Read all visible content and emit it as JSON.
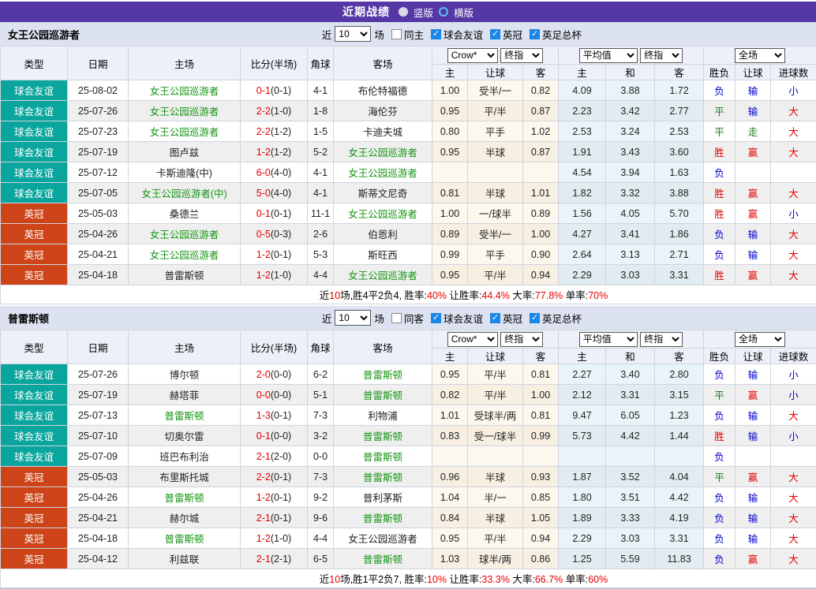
{
  "title_bar": {
    "title": "近期战绩",
    "vertical_label": "竖版",
    "horizontal_label": "横版"
  },
  "icons": {
    "check": "✓"
  },
  "colors": {
    "purple": "#5537a5",
    "teal": "#0aa69e",
    "red_orange": "#cc4417",
    "team_green": "#149414",
    "win_red": "#e60000",
    "lose_blue": "#0000cc",
    "draw_green": "#108010",
    "checkbox_blue": "#1a86e8"
  },
  "filters_common": {
    "near": "近",
    "count": "10",
    "matches": "场",
    "comps": [
      "球会友谊",
      "英冠",
      "英足总杯"
    ]
  },
  "header_selects": {
    "crow": "Crow*",
    "final": "终指",
    "avg": "平均值",
    "full": "全场"
  },
  "headers": {
    "type": "类型",
    "date": "日期",
    "home": "主场",
    "score": "比分(半场)",
    "corner": "角球",
    "away": "客场",
    "h_home": "主",
    "h_handicap": "让球",
    "h_away": "客",
    "a_home": "主",
    "a_draw": "和",
    "a_away": "客",
    "r_result": "胜负",
    "r_handicap": "让球",
    "r_goals": "进球数"
  },
  "sections": [
    {
      "team": "女王公园巡游者",
      "filter": {
        "same_label": "同主",
        "same_checked": false
      },
      "rows": [
        {
          "type": "球会友谊",
          "tc": "t",
          "date": "25-08-02",
          "home": "女王公园巡游者",
          "hg": true,
          "score": "0-1",
          "half": "(0-1)",
          "corner": "4-1",
          "away": "布伦特福德",
          "ag": false,
          "odds": [
            "1.00",
            "受半/一",
            "0.82"
          ],
          "avg": [
            "4.09",
            "3.88",
            "1.72"
          ],
          "res": [
            [
              "负",
              "b"
            ],
            [
              "输",
              "b"
            ],
            [
              "小",
              "b"
            ]
          ]
        },
        {
          "type": "球会友谊",
          "tc": "t",
          "date": "25-07-26",
          "home": "女王公园巡游者",
          "hg": true,
          "score": "2-2",
          "half": "(1-0)",
          "corner": "1-8",
          "away": "海伦芬",
          "ag": false,
          "odds": [
            "0.95",
            "平/半",
            "0.87"
          ],
          "avg": [
            "2.23",
            "3.42",
            "2.77"
          ],
          "res": [
            [
              "平",
              "g"
            ],
            [
              "输",
              "b"
            ],
            [
              "大",
              "r"
            ]
          ]
        },
        {
          "type": "球会友谊",
          "tc": "t",
          "date": "25-07-23",
          "home": "女王公园巡游者",
          "hg": true,
          "score": "2-2",
          "half": "(1-2)",
          "corner": "1-5",
          "away": "卡迪夫城",
          "ag": false,
          "odds": [
            "0.80",
            "平手",
            "1.02"
          ],
          "avg": [
            "2.53",
            "3.24",
            "2.53"
          ],
          "res": [
            [
              "平",
              "g"
            ],
            [
              "走",
              "g"
            ],
            [
              "大",
              "r"
            ]
          ]
        },
        {
          "type": "球会友谊",
          "tc": "t",
          "date": "25-07-19",
          "home": "图卢兹",
          "hg": false,
          "score": "1-2",
          "half": "(1-2)",
          "corner": "5-2",
          "away": "女王公园巡游者",
          "ag": true,
          "odds": [
            "0.95",
            "半球",
            "0.87"
          ],
          "avg": [
            "1.91",
            "3.43",
            "3.60"
          ],
          "res": [
            [
              "胜",
              "r"
            ],
            [
              "赢",
              "r"
            ],
            [
              "大",
              "r"
            ]
          ]
        },
        {
          "type": "球会友谊",
          "tc": "t",
          "date": "25-07-12",
          "home": "卡斯迪隆(中)",
          "hg": false,
          "score": "6-0",
          "half": "(4-0)",
          "corner": "4-1",
          "away": "女王公园巡游者",
          "ag": true,
          "odds": [
            "",
            "",
            ""
          ],
          "avg": [
            "4.54",
            "3.94",
            "1.63"
          ],
          "res": [
            [
              "负",
              "b"
            ],
            [
              "",
              ""
            ],
            [
              "",
              ""
            ]
          ]
        },
        {
          "type": "球会友谊",
          "tc": "t",
          "date": "25-07-05",
          "home": "女王公园巡游者(中)",
          "hg": true,
          "score": "5-0",
          "half": "(4-0)",
          "corner": "4-1",
          "away": "斯蒂文尼奇",
          "ag": false,
          "odds": [
            "0.81",
            "半球",
            "1.01"
          ],
          "avg": [
            "1.82",
            "3.32",
            "3.88"
          ],
          "res": [
            [
              "胜",
              "r"
            ],
            [
              "赢",
              "r"
            ],
            [
              "大",
              "r"
            ]
          ]
        },
        {
          "type": "英冠",
          "tc": "o",
          "date": "25-05-03",
          "home": "桑德兰",
          "hg": false,
          "score": "0-1",
          "half": "(0-1)",
          "corner": "11-1",
          "away": "女王公园巡游者",
          "ag": true,
          "odds": [
            "1.00",
            "一/球半",
            "0.89"
          ],
          "avg": [
            "1.56",
            "4.05",
            "5.70"
          ],
          "res": [
            [
              "胜",
              "r"
            ],
            [
              "赢",
              "r"
            ],
            [
              "小",
              "b"
            ]
          ]
        },
        {
          "type": "英冠",
          "tc": "o",
          "date": "25-04-26",
          "home": "女王公园巡游者",
          "hg": true,
          "score": "0-5",
          "half": "(0-3)",
          "corner": "2-6",
          "away": "伯恩利",
          "ag": false,
          "odds": [
            "0.89",
            "受半/一",
            "1.00"
          ],
          "avg": [
            "4.27",
            "3.41",
            "1.86"
          ],
          "res": [
            [
              "负",
              "b"
            ],
            [
              "输",
              "b"
            ],
            [
              "大",
              "r"
            ]
          ]
        },
        {
          "type": "英冠",
          "tc": "o",
          "date": "25-04-21",
          "home": "女王公园巡游者",
          "hg": true,
          "score": "1-2",
          "half": "(0-1)",
          "corner": "5-3",
          "away": "斯旺西",
          "ag": false,
          "odds": [
            "0.99",
            "平手",
            "0.90"
          ],
          "avg": [
            "2.64",
            "3.13",
            "2.71"
          ],
          "res": [
            [
              "负",
              "b"
            ],
            [
              "输",
              "b"
            ],
            [
              "大",
              "r"
            ]
          ]
        },
        {
          "type": "英冠",
          "tc": "o",
          "date": "25-04-18",
          "home": "普雷斯顿",
          "hg": false,
          "score": "1-2",
          "half": "(1-0)",
          "corner": "4-4",
          "away": "女王公园巡游者",
          "ag": true,
          "odds": [
            "0.95",
            "平/半",
            "0.94"
          ],
          "avg": [
            "2.29",
            "3.03",
            "3.31"
          ],
          "res": [
            [
              "胜",
              "r"
            ],
            [
              "赢",
              "r"
            ],
            [
              "大",
              "r"
            ]
          ]
        }
      ],
      "summary": [
        [
          "近",
          "k"
        ],
        [
          "10",
          "r"
        ],
        [
          "场,胜4平2负4, 胜率:",
          "k"
        ],
        [
          "40%",
          "r"
        ],
        [
          " 让胜率:",
          "k"
        ],
        [
          "44.4%",
          "r"
        ],
        [
          " 大率:",
          "k"
        ],
        [
          "77.8%",
          "r"
        ],
        [
          " 单率:",
          "k"
        ],
        [
          "70%",
          "r"
        ]
      ]
    },
    {
      "team": "普雷斯顿",
      "filter": {
        "same_label": "同客",
        "same_checked": false
      },
      "rows": [
        {
          "type": "球会友谊",
          "tc": "t",
          "date": "25-07-26",
          "home": "博尔顿",
          "hg": false,
          "score": "2-0",
          "half": "(0-0)",
          "corner": "6-2",
          "away": "普雷斯顿",
          "ag": true,
          "odds": [
            "0.95",
            "平/半",
            "0.81"
          ],
          "avg": [
            "2.27",
            "3.40",
            "2.80"
          ],
          "res": [
            [
              "负",
              "b"
            ],
            [
              "输",
              "b"
            ],
            [
              "小",
              "b"
            ]
          ]
        },
        {
          "type": "球会友谊",
          "tc": "t",
          "date": "25-07-19",
          "home": "赫塔菲",
          "hg": false,
          "score": "0-0",
          "half": "(0-0)",
          "corner": "5-1",
          "away": "普雷斯顿",
          "ag": true,
          "odds": [
            "0.82",
            "平/半",
            "1.00"
          ],
          "avg": [
            "2.12",
            "3.31",
            "3.15"
          ],
          "res": [
            [
              "平",
              "g"
            ],
            [
              "赢",
              "r"
            ],
            [
              "小",
              "b"
            ]
          ]
        },
        {
          "type": "球会友谊",
          "tc": "t",
          "date": "25-07-13",
          "home": "普雷斯顿",
          "hg": true,
          "score": "1-3",
          "half": "(0-1)",
          "corner": "7-3",
          "away": "利物浦",
          "ag": false,
          "odds": [
            "1.01",
            "受球半/两",
            "0.81"
          ],
          "avg": [
            "9.47",
            "6.05",
            "1.23"
          ],
          "res": [
            [
              "负",
              "b"
            ],
            [
              "输",
              "b"
            ],
            [
              "大",
              "r"
            ]
          ]
        },
        {
          "type": "球会友谊",
          "tc": "t",
          "date": "25-07-10",
          "home": "切奥尔雷",
          "hg": false,
          "score": "0-1",
          "half": "(0-0)",
          "corner": "3-2",
          "away": "普雷斯顿",
          "ag": true,
          "odds": [
            "0.83",
            "受一/球半",
            "0.99"
          ],
          "avg": [
            "5.73",
            "4.42",
            "1.44"
          ],
          "res": [
            [
              "胜",
              "r"
            ],
            [
              "输",
              "b"
            ],
            [
              "小",
              "b"
            ]
          ]
        },
        {
          "type": "球会友谊",
          "tc": "t",
          "date": "25-07-09",
          "home": "班巴布利治",
          "hg": false,
          "score": "2-1",
          "half": "(2-0)",
          "corner": "0-0",
          "away": "普雷斯顿",
          "ag": true,
          "odds": [
            "",
            "",
            ""
          ],
          "avg": [
            "",
            "",
            ""
          ],
          "res": [
            [
              "负",
              "b"
            ],
            [
              "",
              ""
            ],
            [
              "",
              ""
            ]
          ]
        },
        {
          "type": "英冠",
          "tc": "o",
          "date": "25-05-03",
          "home": "布里斯托城",
          "hg": false,
          "score": "2-2",
          "half": "(0-1)",
          "corner": "7-3",
          "away": "普雷斯顿",
          "ag": true,
          "odds": [
            "0.96",
            "半球",
            "0.93"
          ],
          "avg": [
            "1.87",
            "3.52",
            "4.04"
          ],
          "res": [
            [
              "平",
              "g"
            ],
            [
              "赢",
              "r"
            ],
            [
              "大",
              "r"
            ]
          ]
        },
        {
          "type": "英冠",
          "tc": "o",
          "date": "25-04-26",
          "home": "普雷斯顿",
          "hg": true,
          "score": "1-2",
          "half": "(0-1)",
          "corner": "9-2",
          "away": "普利茅斯",
          "ag": false,
          "odds": [
            "1.04",
            "半/一",
            "0.85"
          ],
          "avg": [
            "1.80",
            "3.51",
            "4.42"
          ],
          "res": [
            [
              "负",
              "b"
            ],
            [
              "输",
              "b"
            ],
            [
              "大",
              "r"
            ]
          ]
        },
        {
          "type": "英冠",
          "tc": "o",
          "date": "25-04-21",
          "home": "赫尔城",
          "hg": false,
          "score": "2-1",
          "half": "(0-1)",
          "corner": "9-6",
          "away": "普雷斯顿",
          "ag": true,
          "odds": [
            "0.84",
            "半球",
            "1.05"
          ],
          "avg": [
            "1.89",
            "3.33",
            "4.19"
          ],
          "res": [
            [
              "负",
              "b"
            ],
            [
              "输",
              "b"
            ],
            [
              "大",
              "r"
            ]
          ]
        },
        {
          "type": "英冠",
          "tc": "o",
          "date": "25-04-18",
          "home": "普雷斯顿",
          "hg": true,
          "score": "1-2",
          "half": "(1-0)",
          "corner": "4-4",
          "away": "女王公园巡游者",
          "ag": false,
          "odds": [
            "0.95",
            "平/半",
            "0.94"
          ],
          "avg": [
            "2.29",
            "3.03",
            "3.31"
          ],
          "res": [
            [
              "负",
              "b"
            ],
            [
              "输",
              "b"
            ],
            [
              "大",
              "r"
            ]
          ]
        },
        {
          "type": "英冠",
          "tc": "o",
          "date": "25-04-12",
          "home": "利兹联",
          "hg": false,
          "score": "2-1",
          "half": "(2-1)",
          "corner": "6-5",
          "away": "普雷斯顿",
          "ag": true,
          "odds": [
            "1.03",
            "球半/两",
            "0.86"
          ],
          "avg": [
            "1.25",
            "5.59",
            "11.83"
          ],
          "res": [
            [
              "负",
              "b"
            ],
            [
              "赢",
              "r"
            ],
            [
              "大",
              "r"
            ]
          ]
        }
      ],
      "summary": [
        [
          "近",
          "k"
        ],
        [
          "10",
          "r"
        ],
        [
          "场,胜1平2负7, 胜率:",
          "k"
        ],
        [
          "10%",
          "r"
        ],
        [
          " 让胜率:",
          "k"
        ],
        [
          "33.3%",
          "r"
        ],
        [
          " 大率:",
          "k"
        ],
        [
          "66.7%",
          "r"
        ],
        [
          " 单率:",
          "k"
        ],
        [
          "60%",
          "r"
        ]
      ]
    }
  ]
}
